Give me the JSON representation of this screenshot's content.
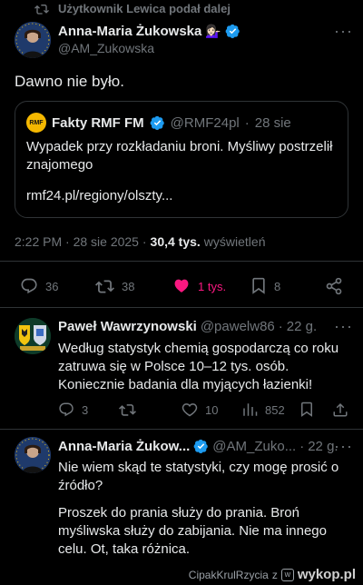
{
  "repost_header": {
    "text": "Użytkownik Lewica podał dalej"
  },
  "main_tweet": {
    "author_name": "Anna-Maria Żukowska",
    "author_emoji": "💁🏻‍♀️",
    "handle": "@AM_Zukowska",
    "text": "Dawno nie było.",
    "quote": {
      "source_logo": "RMF",
      "author_name": "Fakty RMF FM",
      "handle": "@RMF24pl",
      "dot": "·",
      "date": "28 sie",
      "text": "Wypadek przy rozkładaniu broni. Myśliwy postrzelił znajomego",
      "link": "rmf24.pl/regiony/olszty..."
    },
    "time": "2:22 PM · 28 sie 2025 ·",
    "views_count": "30,4 tys.",
    "views_label": "wyświetleń",
    "actions": {
      "replies": "36",
      "reposts": "38",
      "likes": "1 tys.",
      "bookmarks": "8"
    }
  },
  "reply_1": {
    "author_name": "Paweł Wawrzynowski",
    "handle": "@pawelw86",
    "dot": "·",
    "time": "22 g.",
    "text": "Według statystyk chemią gospodarczą co roku zatruwa się w Polsce 10–12 tys. osób. Koniecznie badania dla myjących łazienki!",
    "actions": {
      "replies": "3",
      "reposts": "",
      "likes": "10",
      "views": "852"
    }
  },
  "reply_2": {
    "author_name": "Anna-Maria Żukow...",
    "handle": "@AM_Zuko...",
    "dot": "·",
    "time": "22 g.",
    "text_1": "Nie wiem skąd te statystyki, czy mogę prosić o źródło?",
    "text_2": "Proszek do prania służy do prania. Broń myśliwska służy do zabijania. Nie ma innego celu. Ot, taka różnica."
  },
  "footer": {
    "user": "CipakKrulRzycia",
    "z": "z",
    "brand": "wykop.pl"
  },
  "colors": {
    "verified": "#1d9bf0",
    "like": "#f91880",
    "background": "#000000"
  }
}
